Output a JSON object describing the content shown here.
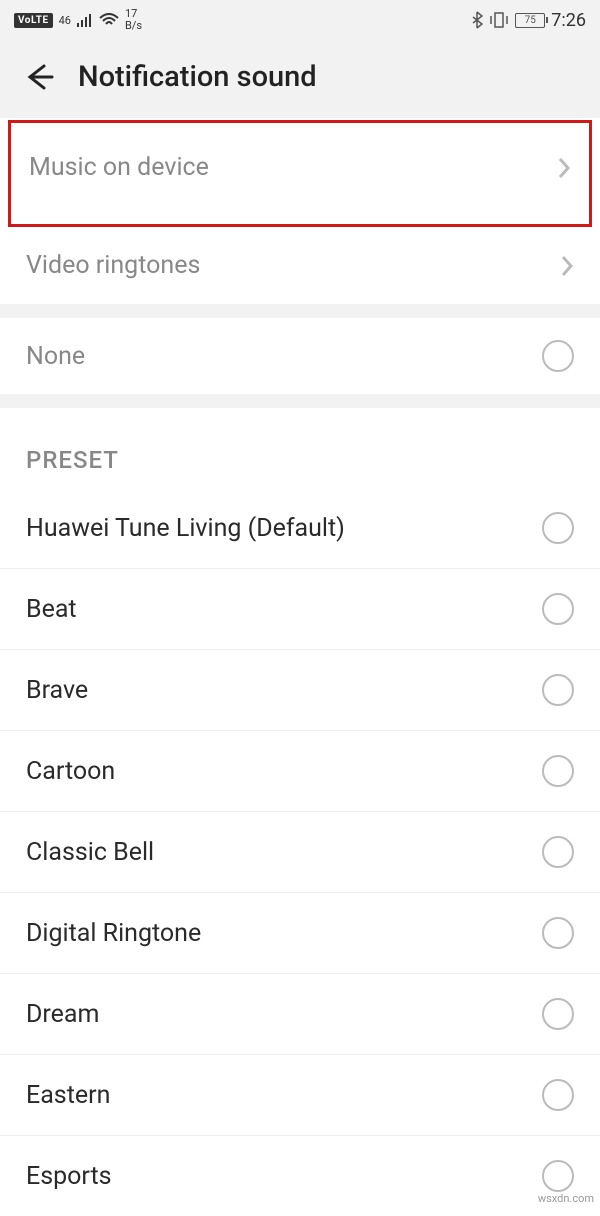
{
  "status": {
    "volte": "VoLTE",
    "signal_4g_top": "46",
    "signal_4g_bottom": "il",
    "speed_value": "17",
    "speed_unit": "B/s",
    "battery_pct": "75",
    "time": "7:26"
  },
  "header": {
    "title": "Notification sound"
  },
  "nav": {
    "music_on_device": "Music on device",
    "video_ringtones": "Video ringtones"
  },
  "none_label": "None",
  "preset_header": "PRESET",
  "presets": [
    "Huawei Tune Living (Default)",
    "Beat",
    "Brave",
    "Cartoon",
    "Classic Bell",
    "Digital Ringtone",
    "Dream",
    "Eastern",
    "Esports"
  ],
  "watermark": "wsxdn.com"
}
